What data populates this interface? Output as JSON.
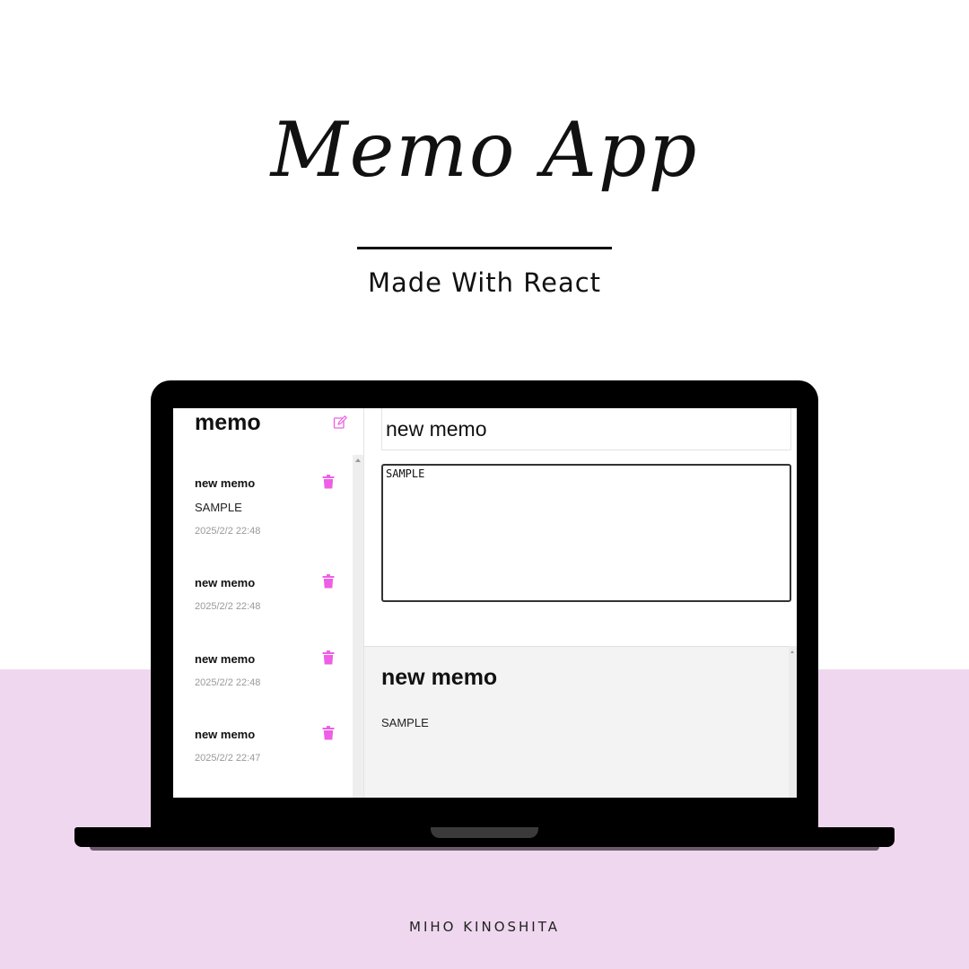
{
  "hero": {
    "title": "Memo App",
    "subtitle": "Made With React",
    "author": "MIHO KINOSHITA"
  },
  "colors": {
    "accent_pink": "#ee5fe6",
    "bottom_background": "#efd8ef"
  },
  "app": {
    "title": "memo",
    "new_icon": "edit-icon",
    "delete_icon": "trash-icon"
  },
  "memos": [
    {
      "title": "new memo",
      "body": "SAMPLE",
      "date": "2025/2/2 22:48"
    },
    {
      "title": "new memo",
      "body": "",
      "date": "2025/2/2 22:48"
    },
    {
      "title": "new memo",
      "body": "",
      "date": "2025/2/2 22:48"
    },
    {
      "title": "new memo",
      "body": "",
      "date": "2025/2/2 22:47"
    }
  ],
  "editor": {
    "title_value": "new memo",
    "body_value": "SAMPLE"
  },
  "preview": {
    "title": "new memo",
    "body": "SAMPLE"
  }
}
